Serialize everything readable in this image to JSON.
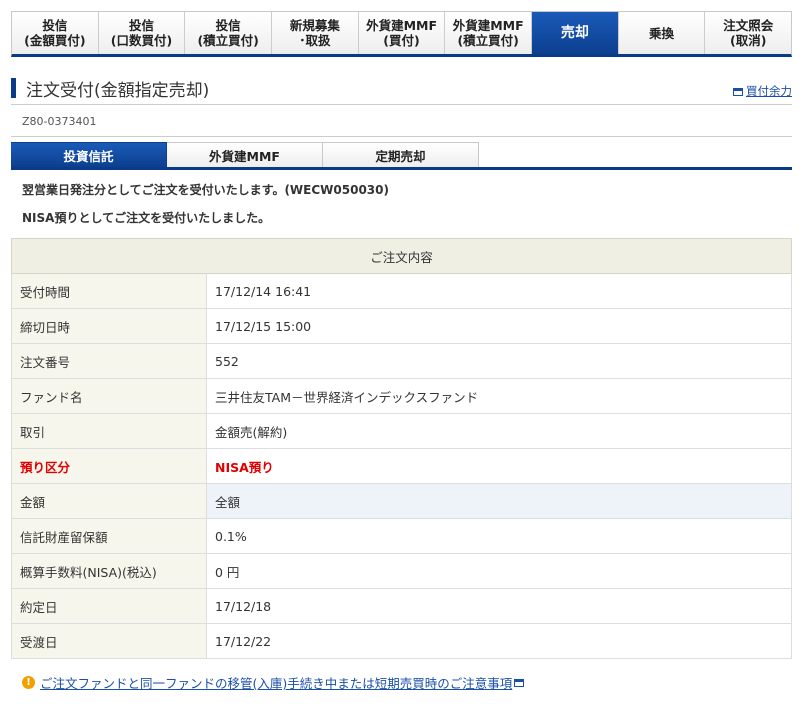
{
  "topnav": {
    "tabs": [
      {
        "label": "投信\n(金額買付)"
      },
      {
        "label": "投信\n(口数買付)"
      },
      {
        "label": "投信\n(積立買付)"
      },
      {
        "label": "新規募集\n･取扱"
      },
      {
        "label": "外貨建MMF\n(買付)"
      },
      {
        "label": "外貨建MMF\n(積立買付)"
      },
      {
        "label": "売却"
      },
      {
        "label": "乗換"
      },
      {
        "label": "注文照会\n(取消)"
      }
    ],
    "active_index": 6
  },
  "page": {
    "title": "注文受付(金額指定売却)",
    "buying_power_link": "買付余力",
    "screen_id": "Z80-0373401"
  },
  "subtabs": {
    "items": [
      {
        "label": "投資信託"
      },
      {
        "label": "外貨建MMF"
      },
      {
        "label": "定期売却"
      }
    ],
    "active_index": 0
  },
  "messages": {
    "line1": "翌営業日発注分としてご注文を受付いたします。(WECW050030)",
    "line2": "NISA預りとしてご注文を受付いたしました。"
  },
  "order_table": {
    "header": "ご注文内容",
    "rows": [
      {
        "label": "受付時間",
        "value": "17/12/14 16:41"
      },
      {
        "label": "締切日時",
        "value": "17/12/15 15:00"
      },
      {
        "label": "注文番号",
        "value": "552"
      },
      {
        "label": "ファンド名",
        "value": "三井住友TAM－世界経済インデックスファンド"
      },
      {
        "label": "取引",
        "value": "金額売(解約)"
      },
      {
        "label": "預り区分",
        "value": "NISA預り"
      },
      {
        "label": "金額",
        "value": "全額"
      },
      {
        "label": "信託財産留保額",
        "value": "0.1%"
      },
      {
        "label": "概算手数料(NISA)(税込)",
        "value": "0 円"
      },
      {
        "label": "約定日",
        "value": "17/12/18"
      },
      {
        "label": "受渡日",
        "value": "17/12/22"
      }
    ]
  },
  "notice": {
    "text": "ご注文ファンドと同一ファンドの移管(入庫)手続き中または短期売買時のご注意事項",
    "icon": "warning-icon"
  },
  "colors": {
    "accent_blue": "#0a3a8a",
    "warning_red": "#e00000",
    "label_bg": "#f7f6ec"
  }
}
